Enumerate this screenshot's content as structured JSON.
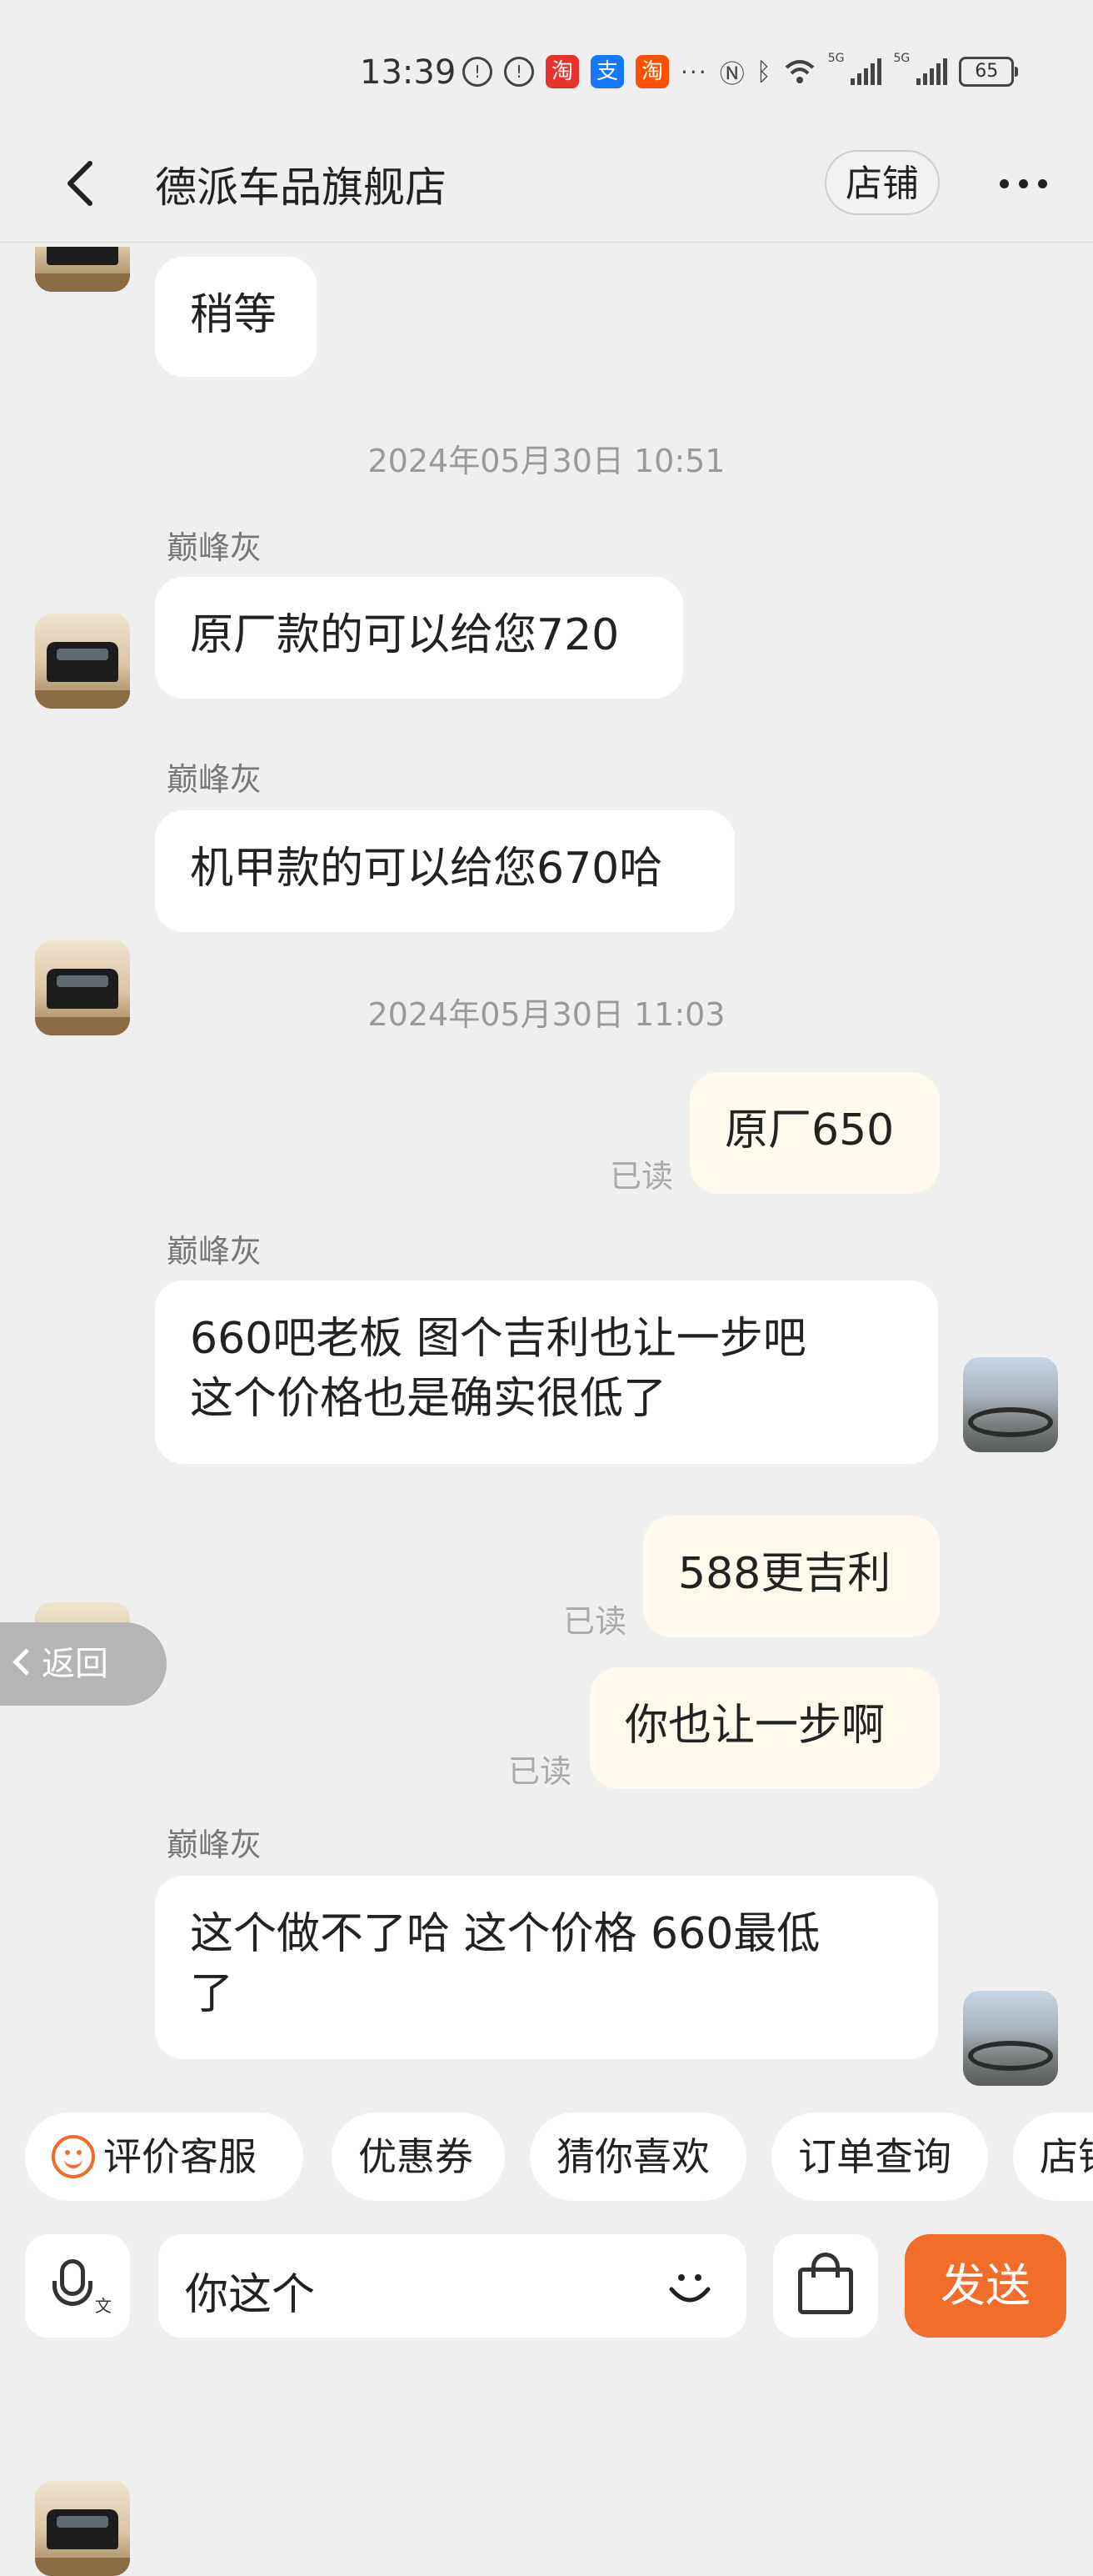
{
  "status_bar": {
    "time": "13:39",
    "alerts": [
      "!",
      "!"
    ],
    "apps": [
      {
        "glyph": "淘",
        "color": "#e8322b"
      },
      {
        "glyph": "支",
        "color": "#1677ff"
      },
      {
        "glyph": "淘",
        "color": "#ff5000"
      }
    ],
    "more": "···",
    "network": [
      "5G",
      "5G"
    ],
    "battery": "65"
  },
  "header": {
    "title": "德派车品旗舰店",
    "shop_button": "店铺"
  },
  "messages": {
    "m0": {
      "text": "稍等"
    },
    "ts1": "2024年05月30日 10:51",
    "m1": {
      "sender": "巅峰灰",
      "text": "原厂款的可以给您720"
    },
    "m2": {
      "sender": "巅峰灰",
      "text": "机甲款的可以给您670哈"
    },
    "ts2": "2024年05月30日 11:03",
    "m3": {
      "text": "原厂650",
      "read": "已读"
    },
    "m4": {
      "sender": "巅峰灰",
      "line1": "660吧老板  图个吉利也让一步吧",
      "line2": "这个价格也是确实很低了"
    },
    "m5": {
      "text": "588更吉利",
      "read": "已读"
    },
    "m6": {
      "text": "你也让一步啊",
      "read": "已读"
    },
    "m7": {
      "sender": "巅峰灰",
      "line1": "这个做不了哈  这个价格  660最低",
      "line2": "了"
    }
  },
  "back_float": "返回",
  "quick_actions": [
    "评价客服",
    "优惠券",
    "猜你喜欢",
    "订单查询",
    "店铺"
  ],
  "input": {
    "value": "你这个",
    "mic_badge": "文",
    "send": "发送"
  }
}
